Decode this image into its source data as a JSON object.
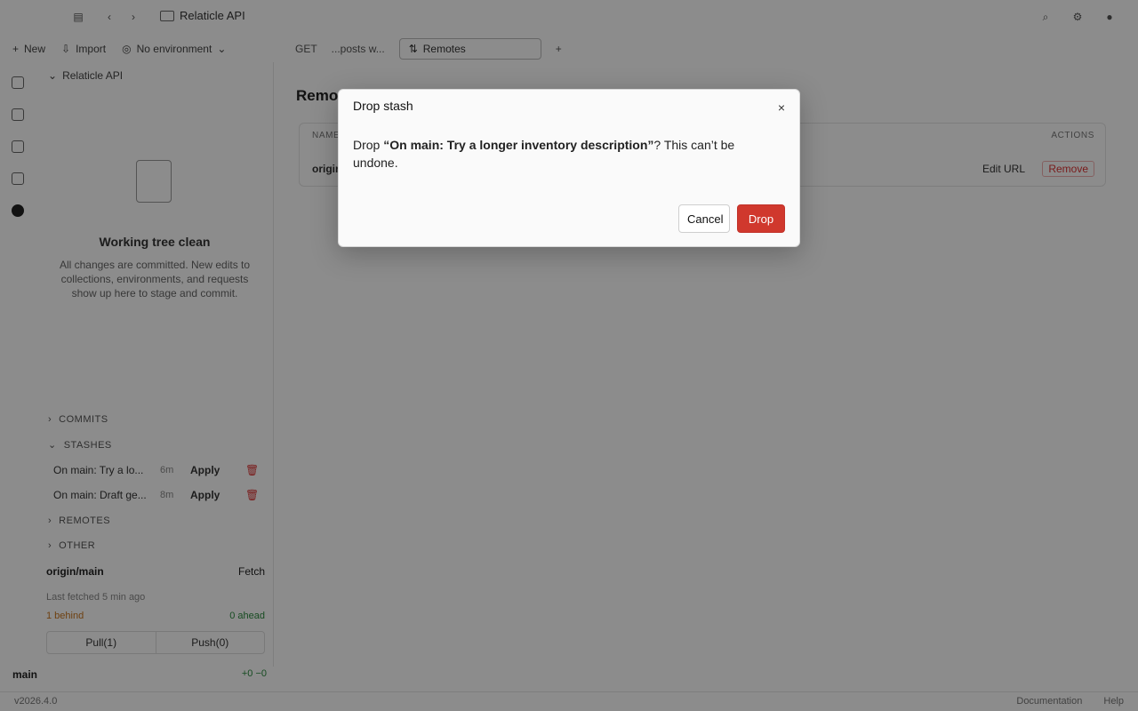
{
  "titlebar": {
    "workspace_name": "Relaticle API",
    "icons": [
      "sidebar-toggle-icon",
      "back-icon",
      "forward-icon",
      "search-icon",
      "settings-icon",
      "avatar"
    ]
  },
  "left_toolbar": {
    "new_label": "New",
    "import_label": "Import",
    "environment_label": "No environment"
  },
  "sidebar": {
    "project_name": "Relaticle API",
    "clean_title": "Working tree clean",
    "clean_description": "All changes are committed. New edits to collections, environments, and requests show up here to stage and commit.",
    "sections": {
      "commits": "COMMITS",
      "stashes": "STASHES",
      "remotes": "REMOTES",
      "other": "OTHER"
    },
    "stashes": [
      {
        "name": "On main: Try a lo...",
        "age": "6m",
        "apply_label": "Apply"
      },
      {
        "name": "On main: Draft ge...",
        "age": "8m",
        "apply_label": "Apply"
      }
    ],
    "branch": {
      "name": "origin/main",
      "action_label": "Fetch",
      "fetched_text": "Last fetched 5 min ago",
      "ahead_label": "1 behind",
      "sync_label": "0 ahead",
      "pull_label": "Pull(1)",
      "push_label": "Push(0)"
    },
    "current_branch": "main",
    "current_branch_changes": "+0  −0"
  },
  "main": {
    "toolbar": {
      "method_label": "GET",
      "path_label": "...posts w...",
      "active_tab_label": "Remotes"
    },
    "title": "Remotes",
    "table": {
      "col_name": "NAME",
      "col_actions": "ACTIONS",
      "row_name": "origin",
      "edit_url_label": "Edit URL",
      "remove_label": "Remove"
    }
  },
  "statusbar": {
    "version": "v2026.4.0",
    "docs_label": "Documentation",
    "help_label": "Help"
  },
  "modal": {
    "title": "Drop stash",
    "body_prefix": "Drop ",
    "stash_name": "“On main: Try a longer inventory description”",
    "body_suffix": "? This can’t be undone.",
    "cancel_label": "Cancel",
    "confirm_label": "Drop",
    "close_glyph": "×"
  },
  "colors": {
    "danger": "#d0382d",
    "overlay": "rgba(0,0,0,0.45)"
  }
}
